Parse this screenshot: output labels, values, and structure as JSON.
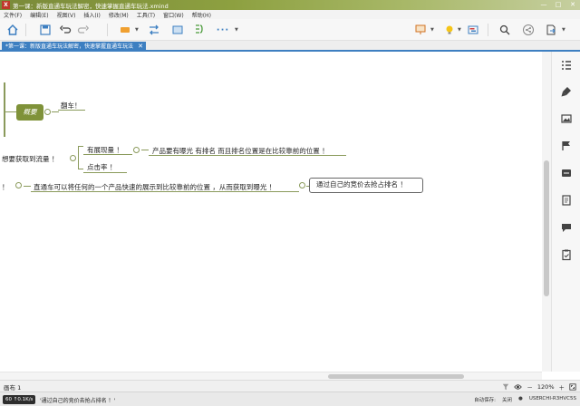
{
  "window": {
    "title": "第一课：新版直通车玩法解密，快速掌握直通车玩法.xmind",
    "controls": [
      "—",
      "□",
      "✕"
    ]
  },
  "menu": [
    "文件(F)",
    "编辑(E)",
    "视图(V)",
    "插入(I)",
    "修改(M)",
    "工具(T)",
    "窗口(W)",
    "帮助(H)"
  ],
  "tab": {
    "label": "*第一课：新版直通车玩法解密，快速掌握直通车玩法",
    "close": "✕"
  },
  "mindmap": {
    "summary_label": "概要",
    "fan_out": "翻车！",
    "want_traffic": "想要获取到流量 ！",
    "has_exposure": "有展现量 ！",
    "exposure_detail": "产品要有曝光 有排名 而且排名位置是在比较靠前的位置 ！",
    "click_rate": "点击率 ！",
    "left_fragment": "！",
    "zhitongche": "直通车可以将任何的一个产品快速的展示到比较靠前的位置 ，从而获取到曝光 ！",
    "selected": "通过自己的竞价去抢占排名 ！"
  },
  "sheetbar": {
    "sheet_label": "画布 1",
    "zoom": "120%",
    "zoom_minus": "－",
    "zoom_plus": "＋"
  },
  "statusbar": {
    "badge": "60 ↑0.1K/s",
    "text": "'通过自己的竞价去抢占排名 ！'",
    "autosave_label": "自动保存:",
    "autosave_value": "关闭",
    "user": "USERCHI-R3HVC5S"
  },
  "colors": {
    "accent": "#3d7fc1",
    "summary_node": "#7f9239",
    "connector": "#8a9a5b"
  },
  "icons": {
    "toolbar": [
      "home-icon",
      "save-icon",
      "undo-icon",
      "redo-icon",
      "topic-icon",
      "relationship-icon",
      "boundary-icon",
      "summary-icon",
      "more-icon",
      "presentation-icon",
      "idea-icon",
      "gantt-icon",
      "search-icon",
      "share-icon",
      "export-icon"
    ],
    "right_panel": [
      "outline-icon",
      "format-brush-icon",
      "image-icon",
      "marker-flag-icon",
      "label-icon",
      "notes-icon",
      "comments-icon",
      "task-icon"
    ]
  }
}
